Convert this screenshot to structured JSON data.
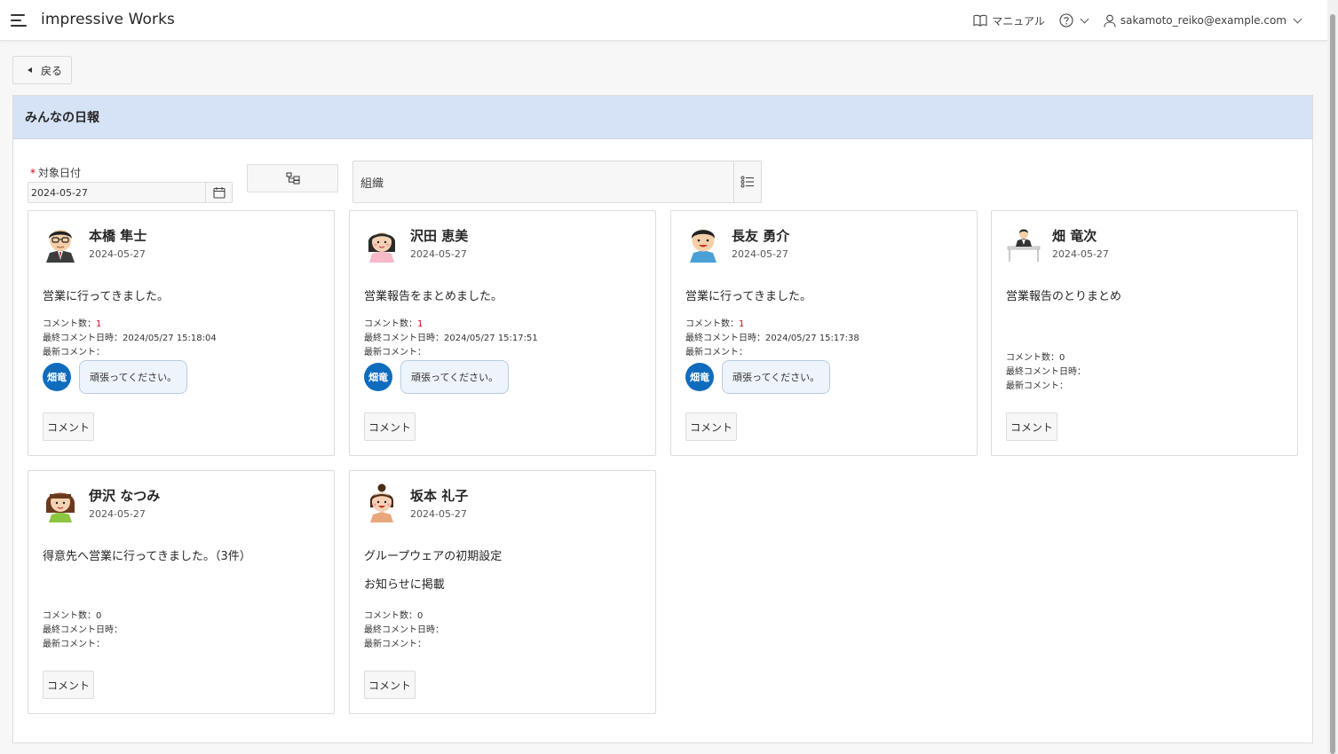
{
  "header": {
    "app_title": "impressive Works",
    "manual_label": "マニュアル",
    "user_email": "sakamoto_reiko@example.com"
  },
  "back_label": "戻る",
  "region": {
    "title": "みんなの日報"
  },
  "filters": {
    "date_required_mark": "*",
    "date_label": "対象日付",
    "date_value": "2024-05-27",
    "org_placeholder": "組織"
  },
  "labels": {
    "comment_count": "コメント数：",
    "last_comment_time": "最終コメント日時：",
    "latest_comment": "最新コメント：",
    "comment_button": "コメント"
  },
  "cards": [
    {
      "name": "本橋 隼士",
      "date": "2024-05-27",
      "body": [
        "営業に行ってきました。"
      ],
      "comment_count": "1",
      "last_comment_time": "2024/05/27 15:18:04",
      "commenter": "畑竜",
      "comment_text": "頑張ってください。"
    },
    {
      "name": "沢田 恵美",
      "date": "2024-05-27",
      "body": [
        "営業報告をまとめました。"
      ],
      "comment_count": "1",
      "last_comment_time": "2024/05/27 15:17:51",
      "commenter": "畑竜",
      "comment_text": "頑張ってください。"
    },
    {
      "name": "長友 勇介",
      "date": "2024-05-27",
      "body": [
        "営業に行ってきました。"
      ],
      "comment_count": "1",
      "last_comment_time": "2024/05/27 15:17:38",
      "commenter": "畑竜",
      "comment_text": "頑張ってください。"
    },
    {
      "name": "畑 竜次",
      "date": "2024-05-27",
      "body": [
        "営業報告のとりまとめ"
      ],
      "comment_count": "0",
      "last_comment_time": "",
      "commenter": "",
      "comment_text": ""
    },
    {
      "name": "伊沢 なつみ",
      "date": "2024-05-27",
      "body": [
        "得意先へ営業に行ってきました。（3件）"
      ],
      "comment_count": "0",
      "last_comment_time": "",
      "commenter": "",
      "comment_text": ""
    },
    {
      "name": "坂本 礼子",
      "date": "2024-05-27",
      "body": [
        "グループウェアの初期設定",
        "お知らせに掲載"
      ],
      "comment_count": "0",
      "last_comment_time": "",
      "commenter": "",
      "comment_text": ""
    }
  ],
  "colors": {
    "header_bg": "#d6e3f6",
    "badge_bg": "#0f6cbd",
    "count_red": "#d0021b"
  }
}
